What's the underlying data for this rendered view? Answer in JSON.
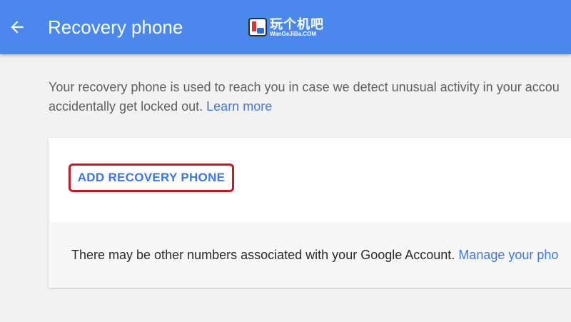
{
  "appbar": {
    "title": "Recovery phone",
    "back_icon": "arrow-back-icon",
    "color": "#4a88ee"
  },
  "watermark": {
    "main": "玩个机吧",
    "sub": "WanGeJiBa.COM"
  },
  "intro": {
    "line1": "Your recovery phone is used to reach you in case we detect unusual activity in your accou",
    "line2_text": "accidentally get locked out.",
    "learn_more": "Learn more"
  },
  "card": {
    "add_button": "ADD RECOVERY PHONE",
    "note_text": "There may be other numbers associated with your Google Account.",
    "note_link": "Manage your pho"
  },
  "colors": {
    "link": "#3b78e7",
    "highlight": "#d1141d"
  }
}
